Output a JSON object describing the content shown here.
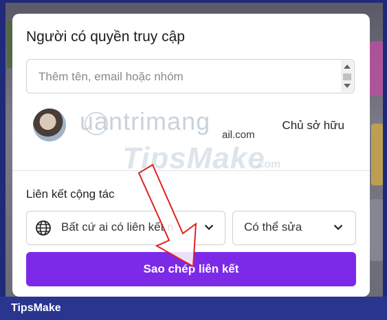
{
  "dialog": {
    "title": "Người có quyền truy cập",
    "search": {
      "placeholder": "Thêm tên, email hoặc nhóm",
      "value": ""
    },
    "member": {
      "email_suffix": "ail.com",
      "role": "Chủ sở hữu"
    },
    "collab": {
      "label": "Liên kết cộng tác",
      "access_value": "Bất cứ ai có liên kết n",
      "permission_value": "Có thể sửa"
    },
    "copy_button_label": "Sao chép liên kết"
  },
  "watermarks": {
    "quantrimang": "uantrimang",
    "tipsmake": "TipsMake",
    "tipsmake_suffix": ".com"
  },
  "footer": {
    "brand": "TipsMake"
  },
  "colors": {
    "accent": "#7d2ae8",
    "arrow": "#e02020",
    "frame": "#2a3590"
  }
}
